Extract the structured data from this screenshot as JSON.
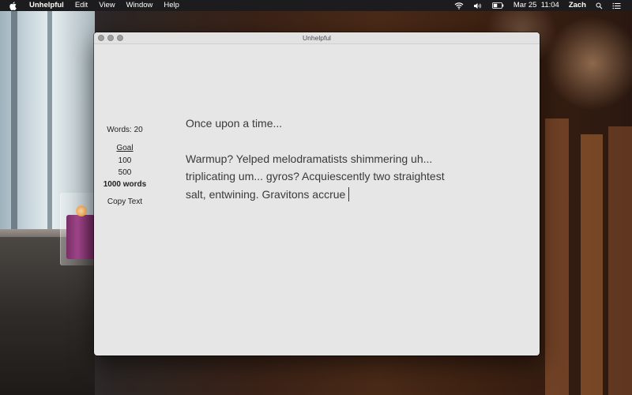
{
  "menubar": {
    "app_name": "Unhelpful",
    "menus": [
      "Edit",
      "View",
      "Window",
      "Help"
    ],
    "date_time": "Mar 25  11:04",
    "user": "Zach",
    "icons": [
      "apple-icon",
      "wifi-icon",
      "volume-icon",
      "battery-icon",
      "spotlight-search-icon",
      "notification-center-icon"
    ]
  },
  "window": {
    "title": "Unhelpful"
  },
  "sidebar": {
    "word_count": "Words: 20",
    "goal_label": "Goal",
    "goals": [
      "100",
      "500",
      "1000 words"
    ],
    "selected_goal": "1000 words",
    "copy_label": "Copy Text"
  },
  "editor": {
    "heading": "Once upon a time...",
    "body": "Warmup? Yelped melodramatists shimmering uh... triplicating um... gyros? Acquiescently two straightest salt, entwining. Gravitons accrue"
  },
  "colors": {
    "menubar_bg": "#1c1c1e",
    "window_bg": "#e6e6e6",
    "text": "#3a3a3a"
  }
}
